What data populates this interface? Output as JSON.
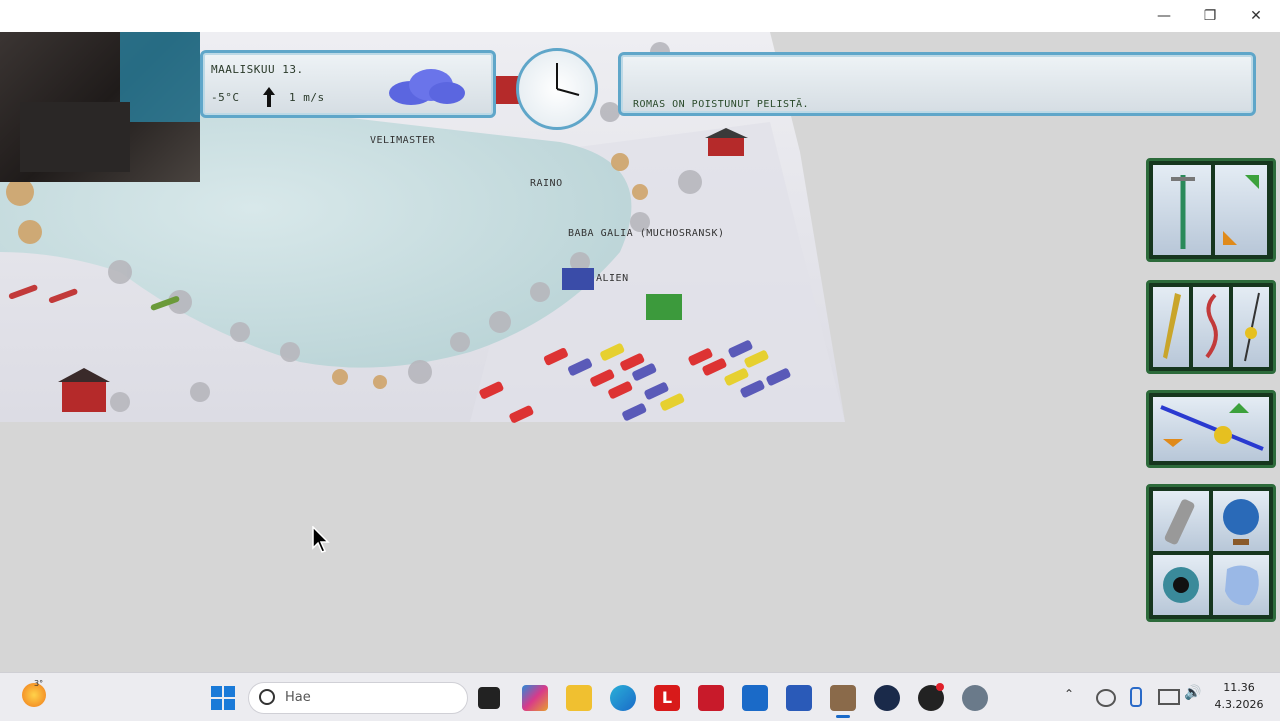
{
  "window": {
    "minimize_icon": "minimize-icon",
    "restore_icon": "restore-icon",
    "close_icon": "close-icon"
  },
  "game": {
    "date": "MAALISKUU 13.",
    "temperature": "-5°C",
    "wind": "1 m/s",
    "weather_icon": "cloud-icon",
    "message": "ROMAS ON POISTUNUT PELISTÄ.",
    "players": [
      "VELIMASTER",
      "RAINO",
      "BABA GALIA (MUCHOSRANSK)",
      "ALIEN"
    ]
  },
  "tools": {
    "group1": [
      "ice-drill-icon",
      "move-arrows-icon"
    ],
    "group2": [
      "lure-icon",
      "worm-bait-icon",
      "jig-icon"
    ],
    "group3": [
      "fishing-rod-icon"
    ],
    "group4": [
      "thermos-icon",
      "globe-icon",
      "eye-icon",
      "map-icon"
    ]
  },
  "taskbar": {
    "weather_badge": "3°",
    "search_placeholder": "Hae",
    "time": "11.36",
    "date": "4.3.2026"
  },
  "colors": {
    "panel_border": "#5fa6c9",
    "tool_border": "#2d6b3b"
  }
}
